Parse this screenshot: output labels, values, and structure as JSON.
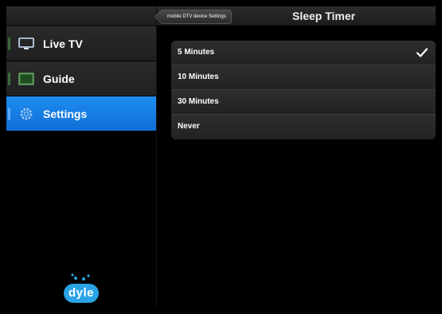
{
  "sidebar": {
    "items": [
      {
        "label": "Live TV",
        "icon": "tv-icon",
        "active": false
      },
      {
        "label": "Guide",
        "icon": "guide-icon",
        "active": false
      },
      {
        "label": "Settings",
        "icon": "settings-gear-icon",
        "active": true
      }
    ],
    "logo_text": "dyle"
  },
  "header": {
    "back_label": "mobile DTV device Settings",
    "title": "Sleep Timer"
  },
  "sleep_timer": {
    "options": [
      {
        "label": "5 Minutes",
        "selected": true
      },
      {
        "label": "10 Minutes",
        "selected": false
      },
      {
        "label": "30 Minutes",
        "selected": false
      },
      {
        "label": "Never",
        "selected": false
      }
    ]
  },
  "colors": {
    "accent": "#1478e6",
    "logo": "#2aa3e6"
  }
}
